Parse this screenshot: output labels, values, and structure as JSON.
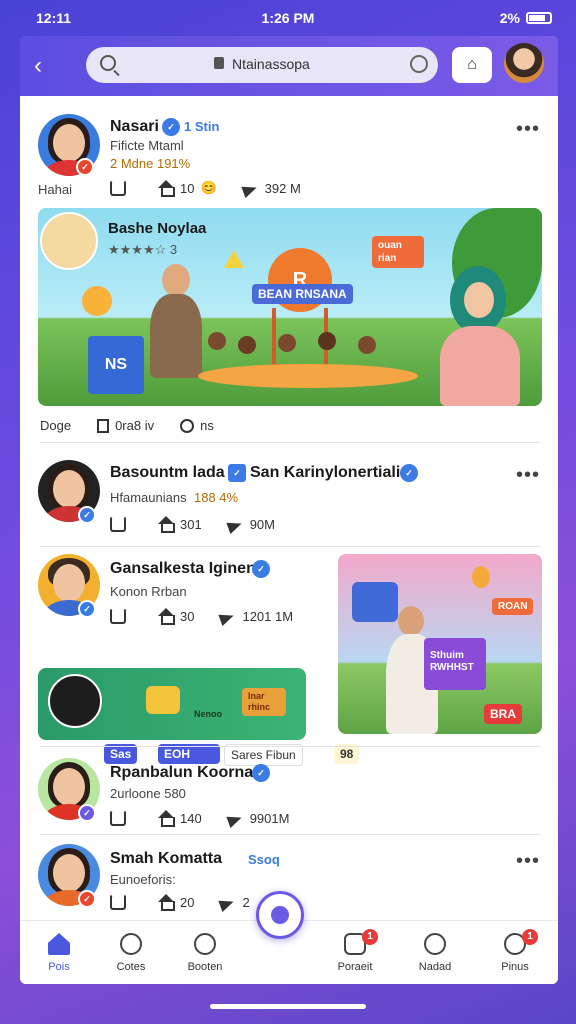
{
  "status": {
    "left": "12:11",
    "time": "1:26 PM",
    "right": "2%"
  },
  "browser": {
    "url": "Ntainassopa"
  },
  "posts": [
    {
      "name": "Nasari",
      "tag": "1 Stin",
      "sub": "Fificte Mtaml",
      "meta": "2 Mdne 191%",
      "label": "Hahai",
      "counts": [
        "",
        "10",
        "392 M"
      ]
    },
    {
      "name": "Bashe Noylaa",
      "meta": "★★★★☆ 3",
      "actions": [
        "Doge",
        "0ra8 iv",
        "ns"
      ],
      "banner_title": "R",
      "banner_pill": "BEAN RNSANA",
      "banner_box": "NS",
      "banner_bubble": "ouan rian"
    },
    {
      "name": "Basountm lada",
      "name2": "San Karinylonertiali",
      "sub": "Hfamaunians",
      "meta": "188 4%",
      "counts": [
        "",
        "301",
        "90M"
      ]
    },
    {
      "name": "Gansalkesta Iginen",
      "sub": "Konon Rrban",
      "counts": [
        "",
        "30",
        "1201 1M"
      ],
      "chip1": "Sas",
      "chip2": "EOH",
      "chip3": "Sares Fibun",
      "chip4": "98",
      "box": "Sthuim RWHHST",
      "red": "BRA",
      "toybox": "lnar rhinc",
      "toypill": "Nenoo",
      "bubble2": "ROAN"
    },
    {
      "name": "Rpanbalun Koornan",
      "sub": "2urloone 580",
      "counts": [
        "",
        "140",
        "9901M"
      ]
    },
    {
      "name": "Smah Komatta",
      "tag": "Ssoq",
      "sub": "Eunoeforis:",
      "counts": [
        "",
        "20",
        "2"
      ]
    }
  ],
  "nav": [
    {
      "label": "Pois",
      "active": true
    },
    {
      "label": "Cotes"
    },
    {
      "label": "Booten"
    },
    {
      "label": "Poraeit",
      "badge": "1"
    },
    {
      "label": "Nadad"
    },
    {
      "label": "Pinus",
      "badge": "1"
    }
  ],
  "colors": {
    "accent": "#5b4ee0",
    "nav_active": "#4a58e0",
    "badge": "#e53b3b",
    "verified": "#3b7be6"
  }
}
